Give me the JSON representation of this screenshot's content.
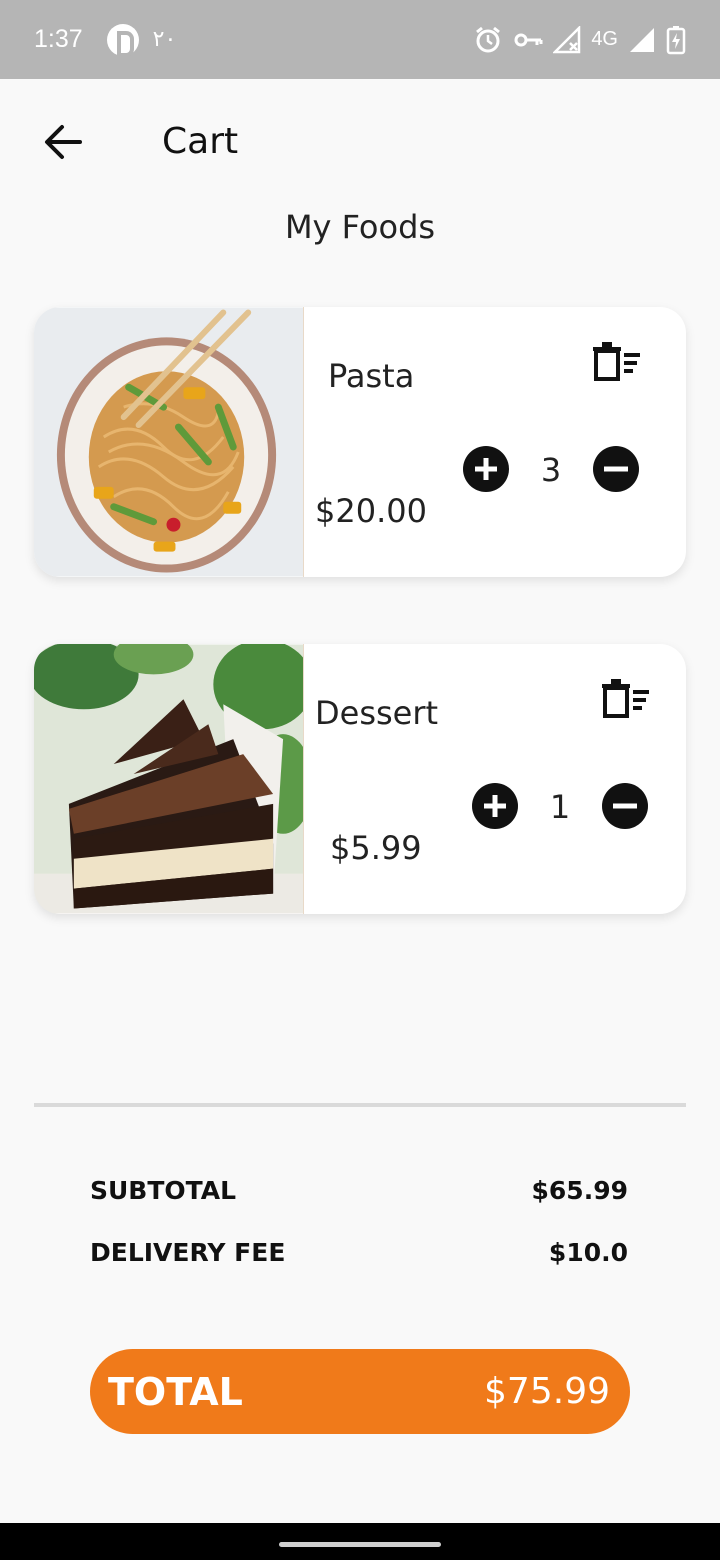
{
  "status_bar": {
    "time": "1:37",
    "arabic_text": "٢٠",
    "network": "4G",
    "icons": [
      "parking-icon",
      "alarm-icon",
      "vpn-key-icon",
      "signal-off-icon",
      "signal-icon",
      "battery-charging-icon"
    ]
  },
  "header": {
    "title": "Cart",
    "back_icon": "arrow-left-icon"
  },
  "section_title": "My Foods",
  "cart_items": [
    {
      "name": "Pasta",
      "price": "$20.00",
      "quantity": "3",
      "image": "noodles-plate-image"
    },
    {
      "name": "Dessert",
      "price": "$5.99",
      "quantity": "1",
      "image": "chocolate-cake-image"
    }
  ],
  "summary": {
    "subtotal_label": "SUBTOTAL",
    "subtotal_value": "$65.99",
    "delivery_label": "DELIVERY FEE",
    "delivery_value": "$10.0"
  },
  "total": {
    "label": "TOTAL",
    "value": "$75.99"
  },
  "colors": {
    "accent": "#f07a1a",
    "status_bar": "#b5b5b5",
    "background": "#f9f9f9"
  }
}
